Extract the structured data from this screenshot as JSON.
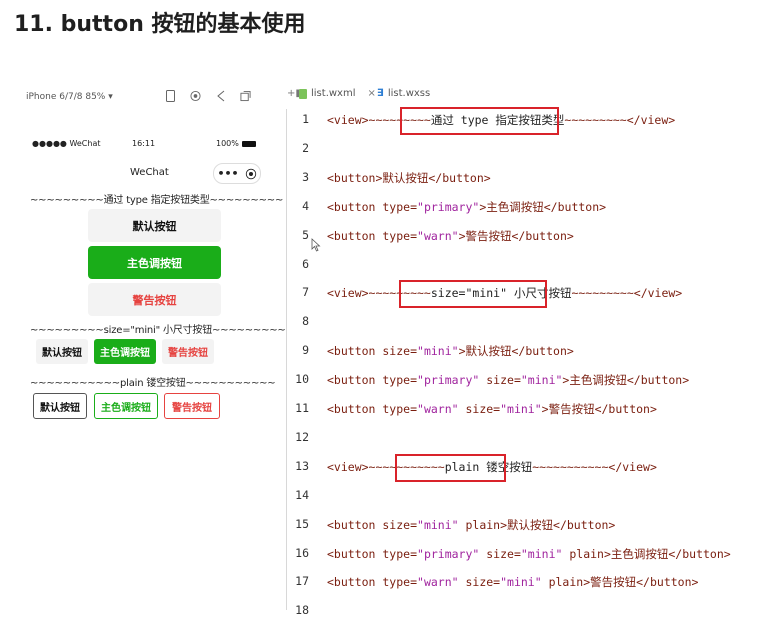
{
  "page_title": "11. button 按钮的基本使用",
  "simulator": {
    "device": "iPhone 6/7/8 85% ▾",
    "status": {
      "carrier": "●●●●● WeChat",
      "time": "16:11",
      "battery": "100%"
    },
    "nav_title": "WeChat",
    "capsule_more": "•••",
    "capsule_close": "⦿",
    "sep1": "~~~~~~~~~通过 type 指定按钮类型~~~~~~~~~",
    "sep2": "~~~~~~~~~size=\"mini\" 小尺寸按钮~~~~~~~~~",
    "sep3": "~~~~~~~~~~~plain 镂空按钮~~~~~~~~~~~",
    "buttons": {
      "default": "默认按钮",
      "primary": "主色调按钮",
      "warn": "警告按钮"
    }
  },
  "editor": {
    "tabs": [
      {
        "label": "list.wxml",
        "active": true
      },
      {
        "label": "list.wxss",
        "active": false
      }
    ],
    "lines": [
      {
        "n": "1",
        "pre": "<view>~~~~~~~~~",
        "mid": "通过 type 指定按钮类型",
        "post": "~~~~~~~~~</view>"
      },
      {
        "n": "2"
      },
      {
        "n": "3",
        "code": "<button>默认按钮</button>"
      },
      {
        "n": "4",
        "code": "<button type=\"primary\">主色调按钮</button>"
      },
      {
        "n": "5",
        "code": "<button type=\"warn\">警告按钮</button>"
      },
      {
        "n": "6"
      },
      {
        "n": "7",
        "pre": "<view>~~~~~~~~~",
        "mid": "size=\"mini\" 小尺寸按钮",
        "post": "~~~~~~~~~</view>"
      },
      {
        "n": "8"
      },
      {
        "n": "9",
        "code": "<button size=\"mini\">默认按钮</button>"
      },
      {
        "n": "10",
        "code": "<button type=\"primary\" size=\"mini\">主色调按钮</button>"
      },
      {
        "n": "11",
        "code": "<button type=\"warn\" size=\"mini\">警告按钮</button>"
      },
      {
        "n": "12"
      },
      {
        "n": "13",
        "pre": "<view>~~~~~~~~~~~",
        "mid": "plain 镂空按钮",
        "post": "~~~~~~~~~~~</view>"
      },
      {
        "n": "14"
      },
      {
        "n": "15",
        "code": "<button size=\"mini\" plain>默认按钮</button>"
      },
      {
        "n": "16",
        "code": "<button type=\"primary\" size=\"mini\" plain>主色调按钮</button>"
      },
      {
        "n": "17",
        "code": "<button type=\"warn\" size=\"mini\" plain>警告按钮</button>"
      },
      {
        "n": "18"
      }
    ]
  },
  "colors": {
    "primary_green": "#1aad19",
    "warn_red": "#e64340",
    "highlight_red": "#d9232a"
  }
}
